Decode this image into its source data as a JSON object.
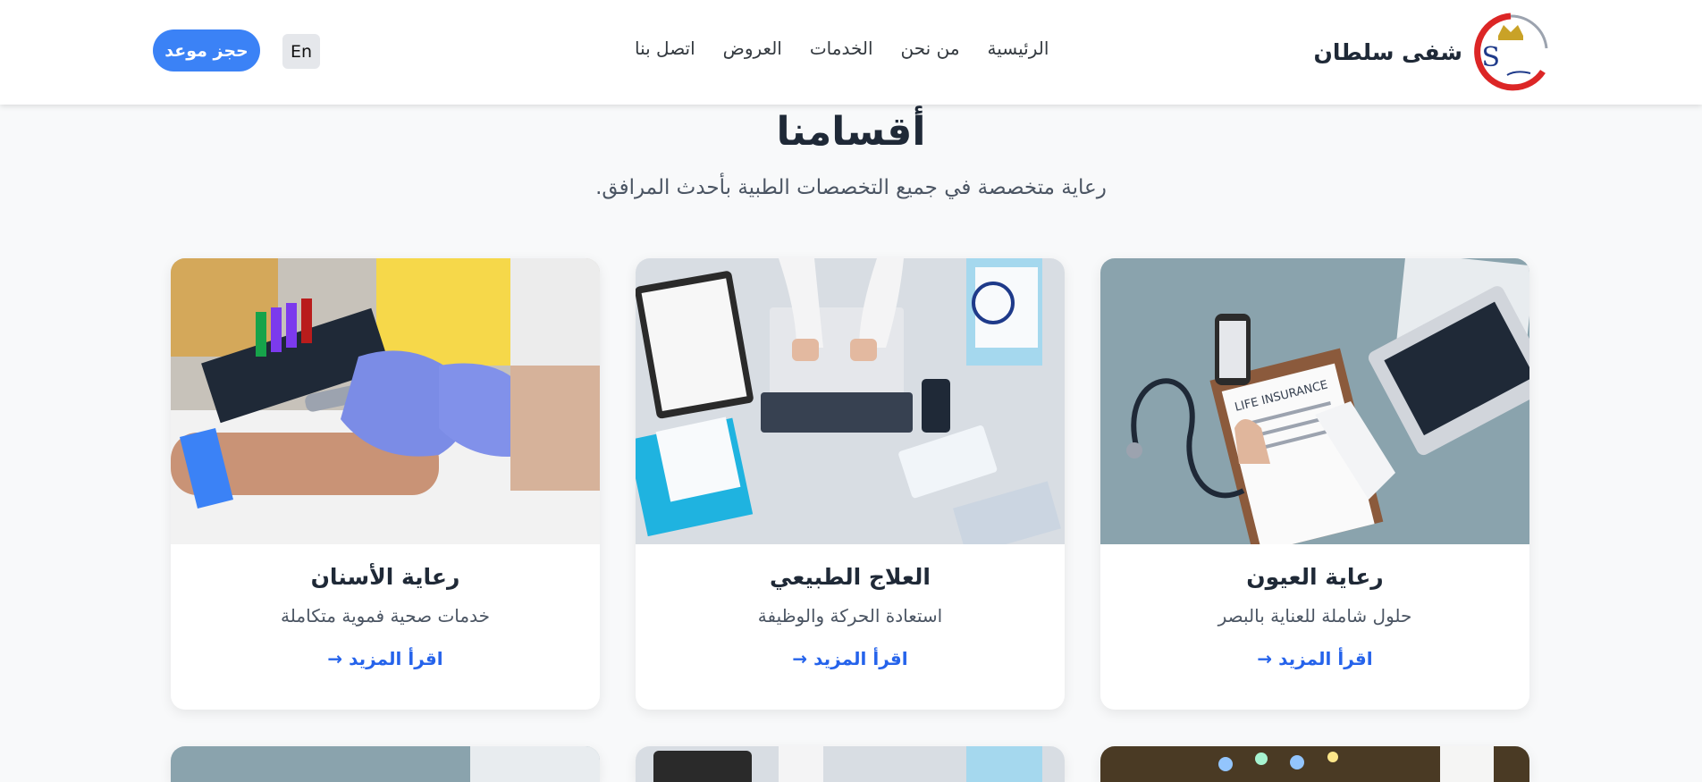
{
  "header": {
    "brand_name": "شفى سلطان",
    "nav": [
      "الرئيسية",
      "من نحن",
      "الخدمات",
      "العروض",
      "اتصل بنا"
    ],
    "lang_label": "En",
    "book_label": "حجز موعد"
  },
  "section": {
    "title": "أقسامنا",
    "subtitle": "رعاية متخصصة في جميع التخصصات الطبية بأحدث المرافق."
  },
  "cards": [
    {
      "title": "رعاية العيون",
      "desc": "حلول شاملة للعناية بالبصر",
      "link": "اقرأ المزيد →"
    },
    {
      "title": "العلاج الطبيعي",
      "desc": "استعادة الحركة والوظيفة",
      "link": "اقرأ المزيد →"
    },
    {
      "title": "رعاية الأسنان",
      "desc": "خدمات صحية فموية متكاملة",
      "link": "اقرأ المزيد →"
    }
  ],
  "images": {
    "card1_label": "LIFE INSURANCE"
  },
  "colors": {
    "accent": "#3b82f6",
    "link": "#2563eb"
  }
}
